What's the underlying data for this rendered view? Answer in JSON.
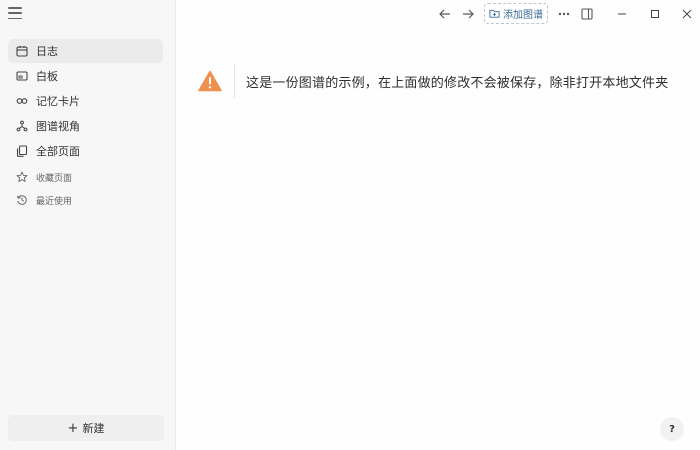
{
  "sidebar": {
    "menu_icon": "hamburger-menu-icon",
    "items": [
      {
        "label": "日志",
        "icon": "calendar-icon",
        "active": true
      },
      {
        "label": "白板",
        "icon": "whiteboard-icon"
      },
      {
        "label": "记忆卡片",
        "icon": "infinity-icon"
      },
      {
        "label": "图谱视角",
        "icon": "graph-nodes-icon"
      },
      {
        "label": "全部页面",
        "icon": "pages-icon"
      }
    ],
    "secondary": [
      {
        "label": "收藏页面",
        "icon": "star-icon"
      },
      {
        "label": "最近使用",
        "icon": "history-icon"
      }
    ],
    "new_button": {
      "label": "新建",
      "icon": "plus-icon"
    }
  },
  "toolbar": {
    "back_icon": "arrow-left-icon",
    "forward_icon": "arrow-right-icon",
    "add_graph_label": "添加图谱",
    "add_graph_icon": "folder-plus-icon",
    "more_icon": "more-dots-icon",
    "sidebar_toggle_icon": "right-sidebar-icon",
    "minimize_icon": "minimize-icon",
    "maximize_icon": "maximize-icon",
    "close_icon": "close-icon"
  },
  "notice": {
    "icon": "warning-icon",
    "color": "#f0904f",
    "message": "这是一份图谱的示例，在上面做的修改不会被保存，除非打开本地文件夹"
  },
  "help": {
    "label": "?"
  }
}
